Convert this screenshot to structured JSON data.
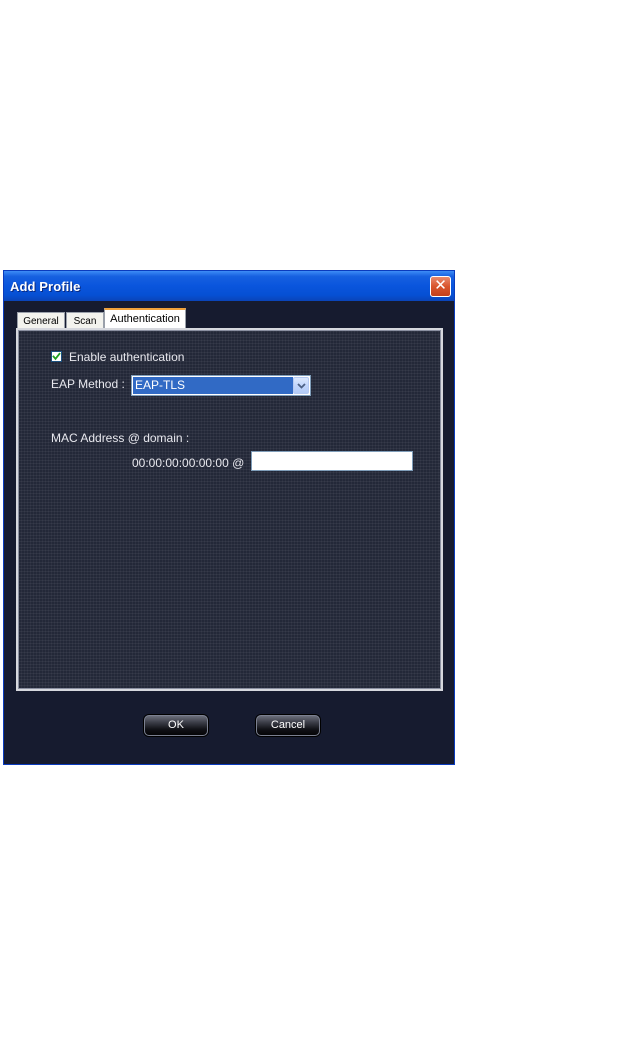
{
  "window": {
    "title": "Add Profile",
    "close_symbol": "✕"
  },
  "tabs": [
    {
      "label": "General",
      "active": false
    },
    {
      "label": "Scan",
      "active": false
    },
    {
      "label": "Authentication",
      "active": true
    }
  ],
  "auth": {
    "enable_label": "Enable authentication",
    "enable_checked": true,
    "eap_label": "EAP Method :",
    "eap_value": "EAP-TLS",
    "mac_label": "MAC Address @ domain :",
    "mac_value": "00:00:00:00:00:00 @",
    "domain_value": ""
  },
  "buttons": {
    "ok_label": "OK",
    "cancel_label": "Cancel"
  },
  "icons": {
    "checkbox_check": "check-icon",
    "select_arrow": "chevron-down-icon",
    "close": "close-icon"
  },
  "colors": {
    "titlebar": "#0a55dd",
    "client_bg": "#161b2f",
    "selection": "#316ac5",
    "active_tab_accent": "#f0a23a"
  }
}
